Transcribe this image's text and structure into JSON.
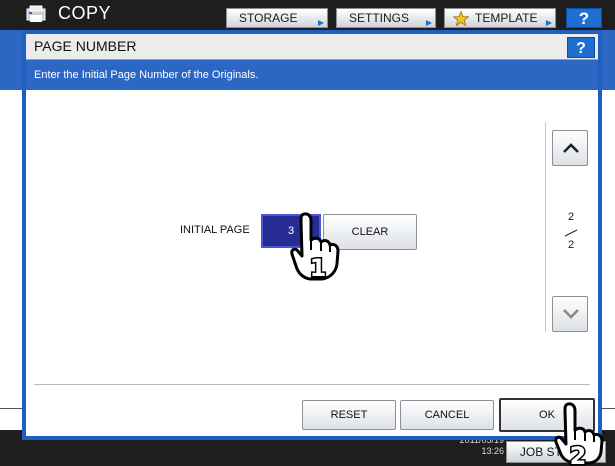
{
  "app": {
    "title": "COPY",
    "tabs": [
      {
        "label": "STORAGE"
      },
      {
        "label": "SETTINGS"
      },
      {
        "label": "TEMPLATE"
      }
    ],
    "help_label": "?"
  },
  "dialog": {
    "title": "PAGE NUMBER",
    "help_label": "?",
    "instruction": "Enter the Initial Page Number of the Originals.",
    "field_label": "INITIAL PAGE",
    "field_value": "3",
    "clear_label": "CLEAR",
    "pagination": {
      "current": "2",
      "total": "2"
    },
    "buttons": {
      "reset": "RESET",
      "cancel": "CANCEL",
      "ok": "OK"
    }
  },
  "status": {
    "date": "2011/05/19",
    "time": "13:26",
    "job_status_label": "JOB STATUS"
  },
  "callouts": [
    "1",
    "2"
  ],
  "icons": {
    "app": "copy-icon",
    "template": "star-icon",
    "scroll_up": "chevron-up-icon",
    "scroll_down": "chevron-down-icon",
    "callout": "pointing-hand-icon"
  },
  "colors": {
    "dialog_border": "#1f5fbf",
    "instruction_bar": "#2c67c4",
    "field_fill": "#262c94",
    "help_button": "#1f6fd3",
    "tab_arrow": "#1d6fd0"
  }
}
